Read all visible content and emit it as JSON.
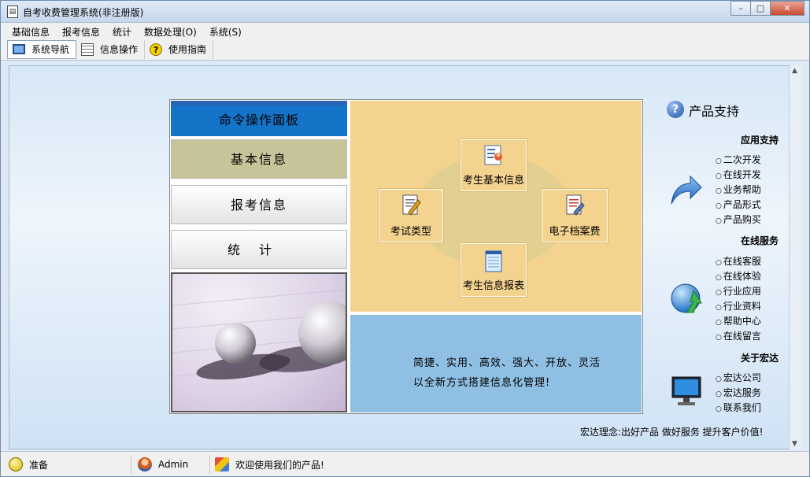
{
  "window": {
    "title": "自考收费管理系统(非注册版)",
    "minimize": "–",
    "maximize": "□",
    "close": "✕"
  },
  "menu": {
    "items": [
      "基础信息",
      "报考信息",
      "统计",
      "数据处理(O)",
      "系统(S)"
    ]
  },
  "toolbar": {
    "nav_label": "系统导航",
    "info_label": "信息操作",
    "help_label": "使用指南"
  },
  "panel": {
    "header": "命令操作面板",
    "btn_basic": "基本信息",
    "btn_report": "报考信息",
    "btn_stats": "统计"
  },
  "center": {
    "node_student_info": "考生基本信息",
    "node_exam_type": "考试类型",
    "node_archive_fee": "电子档案费",
    "node_report_table": "考生信息报表",
    "desc_line1": "简捷、实用、高效、强大、开放、灵活",
    "desc_line2": "以全新方式搭建信息化管理!"
  },
  "support": {
    "title": "产品支持",
    "app_support": {
      "title": "应用支持",
      "links": [
        "二次开发",
        "在线开发",
        "业务帮助",
        "产品形式",
        "产品购买"
      ]
    },
    "online_service": {
      "title": "在线服务",
      "links": [
        "在线客服",
        "在线体验",
        "行业应用",
        "行业资料",
        "帮助中心",
        "在线留言"
      ]
    },
    "about": {
      "title": "关于宏达",
      "links": [
        "宏达公司",
        "宏达服务",
        "联系我们"
      ]
    },
    "motto": "宏达理念:出好产品 做好服务 提升客户价值!"
  },
  "status": {
    "ready": "准备",
    "user": "Admin",
    "message": "欢迎使用我们的产品!"
  },
  "colors": {
    "header_blue": "#1374c8",
    "center_yellow": "#f4d38f",
    "desc_blue": "#8fbfe3"
  }
}
